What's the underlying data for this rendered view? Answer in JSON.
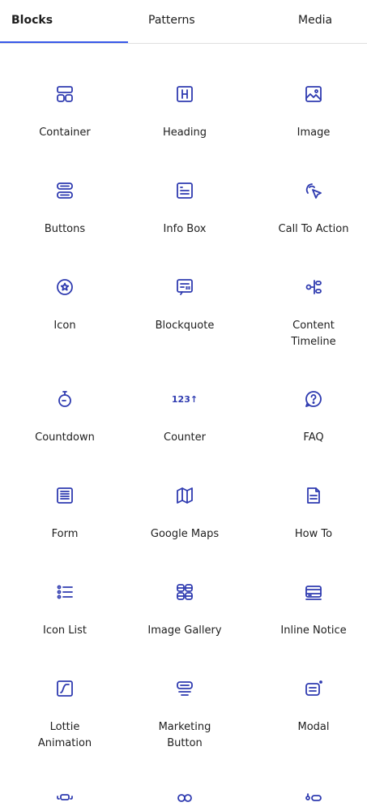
{
  "tabs": [
    {
      "label": "Blocks",
      "active": true
    },
    {
      "label": "Patterns",
      "active": false
    },
    {
      "label": "Media",
      "active": false
    }
  ],
  "accent_color": "#3858e9",
  "icon_color": "#2f3bb0",
  "blocks": [
    {
      "label": "Container",
      "icon": "container-icon"
    },
    {
      "label": "Heading",
      "icon": "heading-icon"
    },
    {
      "label": "Image",
      "icon": "image-icon"
    },
    {
      "label": "Buttons",
      "icon": "buttons-icon"
    },
    {
      "label": "Info Box",
      "icon": "info-box-icon"
    },
    {
      "label": "Call To Action",
      "icon": "call-to-action-icon"
    },
    {
      "label": "Icon",
      "icon": "star-circle-icon"
    },
    {
      "label": "Blockquote",
      "icon": "blockquote-icon"
    },
    {
      "label": "Content Timeline",
      "icon": "timeline-icon"
    },
    {
      "label": "Countdown",
      "icon": "stopwatch-icon"
    },
    {
      "label": "Counter",
      "icon": "counter-icon",
      "glyph": "123↑"
    },
    {
      "label": "FAQ",
      "icon": "question-icon"
    },
    {
      "label": "Form",
      "icon": "form-icon"
    },
    {
      "label": "Google Maps",
      "icon": "map-icon"
    },
    {
      "label": "How To",
      "icon": "how-to-icon"
    },
    {
      "label": "Icon List",
      "icon": "icon-list-icon"
    },
    {
      "label": "Image Gallery",
      "icon": "gallery-icon"
    },
    {
      "label": "Inline Notice",
      "icon": "inline-notice-icon"
    },
    {
      "label": "Lottie Animation",
      "icon": "lottie-icon"
    },
    {
      "label": "Marketing Button",
      "icon": "marketing-button-icon"
    },
    {
      "label": "Modal",
      "icon": "modal-icon"
    },
    {
      "label": "",
      "icon": "partial-icon-1"
    },
    {
      "label": "",
      "icon": "partial-icon-2"
    },
    {
      "label": "",
      "icon": "partial-icon-3"
    }
  ]
}
